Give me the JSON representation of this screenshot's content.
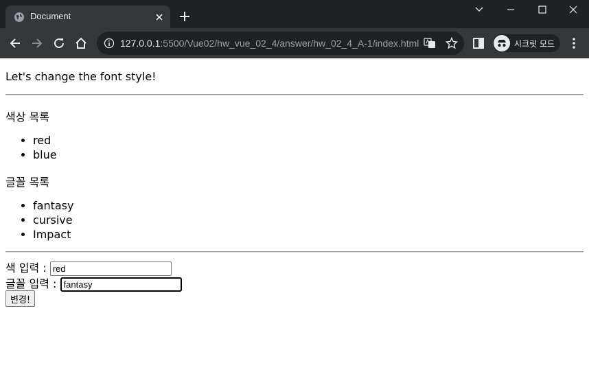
{
  "browser": {
    "tab_title": "Document",
    "url_host": "127.0.0.1",
    "url_path": ":5500/Vue02/hw_vue_02_4/answer/hw_02_4_A-1/index.html",
    "incognito_label": "시크릿 모드"
  },
  "page": {
    "headline": "Let's change the font style!",
    "colors_title": "색상 목록",
    "colors": [
      "red",
      "blue"
    ],
    "fonts_title": "글꼴 목록",
    "fonts": [
      "fantasy",
      "cursive",
      "Impact"
    ],
    "color_label": "색 입력 :",
    "color_value": "red",
    "font_label": "글꼴 입력 :",
    "font_value": "fantasy",
    "apply_button": "변경!"
  },
  "icons": {
    "tab_favicon": "globe-icon",
    "tab_close": "close-icon",
    "new_tab": "plus-icon",
    "back": "arrow-left-icon",
    "forward": "arrow-right-icon",
    "reload": "reload-icon",
    "home": "home-icon",
    "site_info": "info-icon",
    "translate": "translate-icon",
    "bookmark": "star-icon",
    "side_panel": "side-panel-icon",
    "incognito": "incognito-icon",
    "menu": "kebab-menu-icon"
  }
}
